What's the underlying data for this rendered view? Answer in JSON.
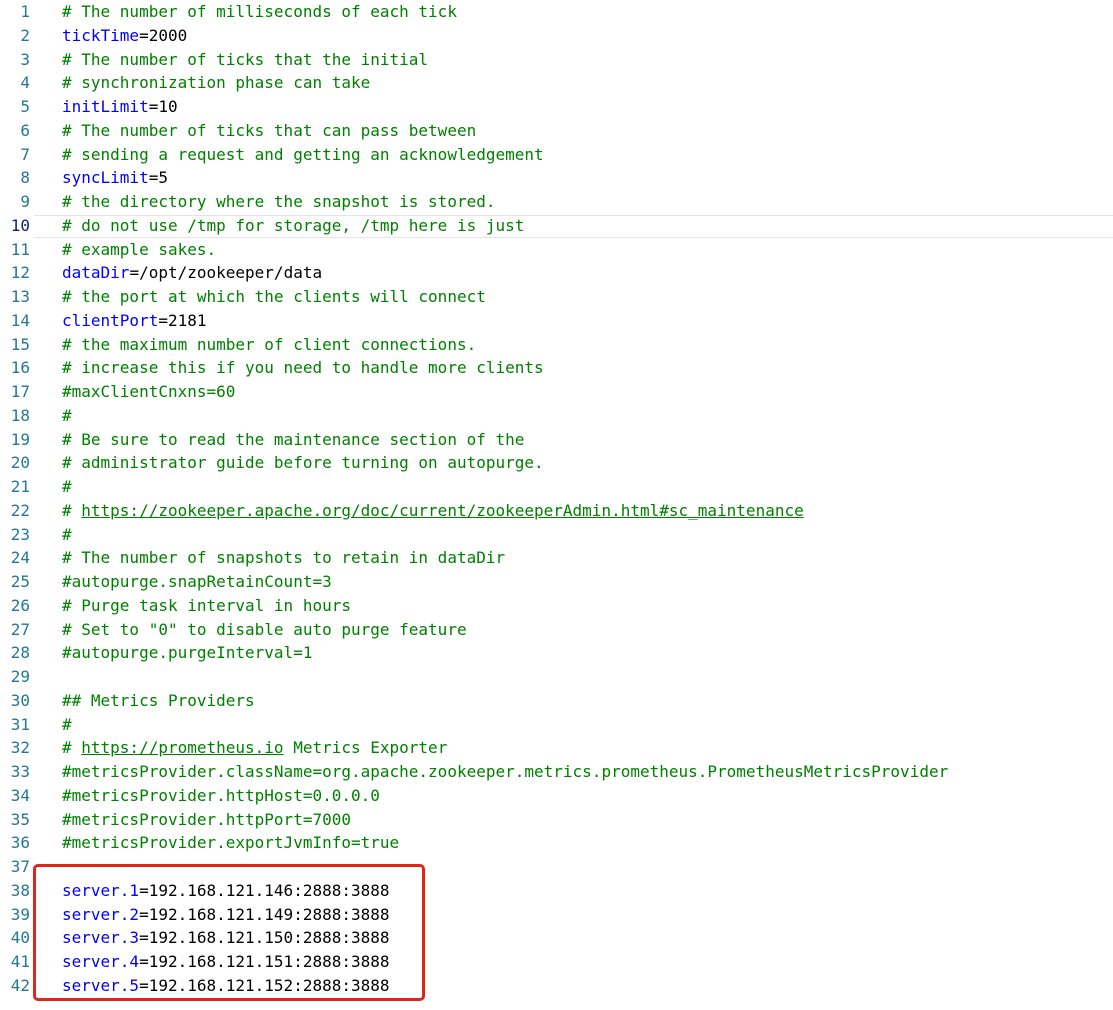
{
  "editor": {
    "current_line": 10,
    "lines": [
      {
        "n": "1",
        "type": "comment",
        "text": "# The number of milliseconds of each tick"
      },
      {
        "n": "2",
        "type": "kv",
        "key": "tickTime",
        "value": "=2000"
      },
      {
        "n": "3",
        "type": "comment",
        "text": "# The number of ticks that the initial"
      },
      {
        "n": "4",
        "type": "comment",
        "text": "# synchronization phase can take"
      },
      {
        "n": "5",
        "type": "kv",
        "key": "initLimit",
        "value": "=10"
      },
      {
        "n": "6",
        "type": "comment",
        "text": "# The number of ticks that can pass between"
      },
      {
        "n": "7",
        "type": "comment",
        "text": "# sending a request and getting an acknowledgement"
      },
      {
        "n": "8",
        "type": "kv",
        "key": "syncLimit",
        "value": "=5"
      },
      {
        "n": "9",
        "type": "comment",
        "text": "# the directory where the snapshot is stored."
      },
      {
        "n": "10",
        "type": "comment",
        "text": "# do not use /tmp for storage, /tmp here is just"
      },
      {
        "n": "11",
        "type": "comment",
        "text": "# example sakes."
      },
      {
        "n": "12",
        "type": "kv",
        "key": "dataDir",
        "value": "=/opt/zookeeper/data"
      },
      {
        "n": "13",
        "type": "comment",
        "text": "# the port at which the clients will connect"
      },
      {
        "n": "14",
        "type": "kv",
        "key": "clientPort",
        "value": "=2181"
      },
      {
        "n": "15",
        "type": "comment",
        "text": "# the maximum number of client connections."
      },
      {
        "n": "16",
        "type": "comment",
        "text": "# increase this if you need to handle more clients"
      },
      {
        "n": "17",
        "type": "comment",
        "text": "#maxClientCnxns=60"
      },
      {
        "n": "18",
        "type": "comment",
        "text": "#"
      },
      {
        "n": "19",
        "type": "comment",
        "text": "# Be sure to read the maintenance section of the"
      },
      {
        "n": "20",
        "type": "comment",
        "text": "# administrator guide before turning on autopurge."
      },
      {
        "n": "21",
        "type": "comment",
        "text": "#"
      },
      {
        "n": "22",
        "type": "comment_link",
        "prefix": "# ",
        "link": "https://zookeeper.apache.org/doc/current/zookeeperAdmin.html#sc_maintenance",
        "suffix": ""
      },
      {
        "n": "23",
        "type": "comment",
        "text": "#"
      },
      {
        "n": "24",
        "type": "comment",
        "text": "# The number of snapshots to retain in dataDir"
      },
      {
        "n": "25",
        "type": "comment",
        "text": "#autopurge.snapRetainCount=3"
      },
      {
        "n": "26",
        "type": "comment",
        "text": "# Purge task interval in hours"
      },
      {
        "n": "27",
        "type": "comment",
        "text": "# Set to \"0\" to disable auto purge feature"
      },
      {
        "n": "28",
        "type": "comment",
        "text": "#autopurge.purgeInterval=1"
      },
      {
        "n": "29",
        "type": "blank",
        "text": ""
      },
      {
        "n": "30",
        "type": "comment",
        "text": "## Metrics Providers"
      },
      {
        "n": "31",
        "type": "comment",
        "text": "#"
      },
      {
        "n": "32",
        "type": "comment_link",
        "prefix": "# ",
        "link": "https://prometheus.io",
        "suffix": " Metrics Exporter"
      },
      {
        "n": "33",
        "type": "comment",
        "text": "#metricsProvider.className=org.apache.zookeeper.metrics.prometheus.PrometheusMetricsProvider"
      },
      {
        "n": "34",
        "type": "comment",
        "text": "#metricsProvider.httpHost=0.0.0.0"
      },
      {
        "n": "35",
        "type": "comment",
        "text": "#metricsProvider.httpPort=7000"
      },
      {
        "n": "36",
        "type": "comment",
        "text": "#metricsProvider.exportJvmInfo=true"
      },
      {
        "n": "37",
        "type": "blank",
        "text": ""
      },
      {
        "n": "38",
        "type": "kv",
        "key": "server.1",
        "value": "=192.168.121.146:2888:3888"
      },
      {
        "n": "39",
        "type": "kv",
        "key": "server.2",
        "value": "=192.168.121.149:2888:3888"
      },
      {
        "n": "40",
        "type": "kv",
        "key": "server.3",
        "value": "=192.168.121.150:2888:3888"
      },
      {
        "n": "41",
        "type": "kv",
        "key": "server.4",
        "value": "=192.168.121.151:2888:3888"
      },
      {
        "n": "42",
        "type": "kv",
        "key": "server.5",
        "value": "=192.168.121.152:2888:3888"
      }
    ]
  },
  "colors": {
    "comment": "#008000",
    "key": "#0000ff",
    "line_number": "#237893",
    "highlight_border": "#e0251c"
  }
}
